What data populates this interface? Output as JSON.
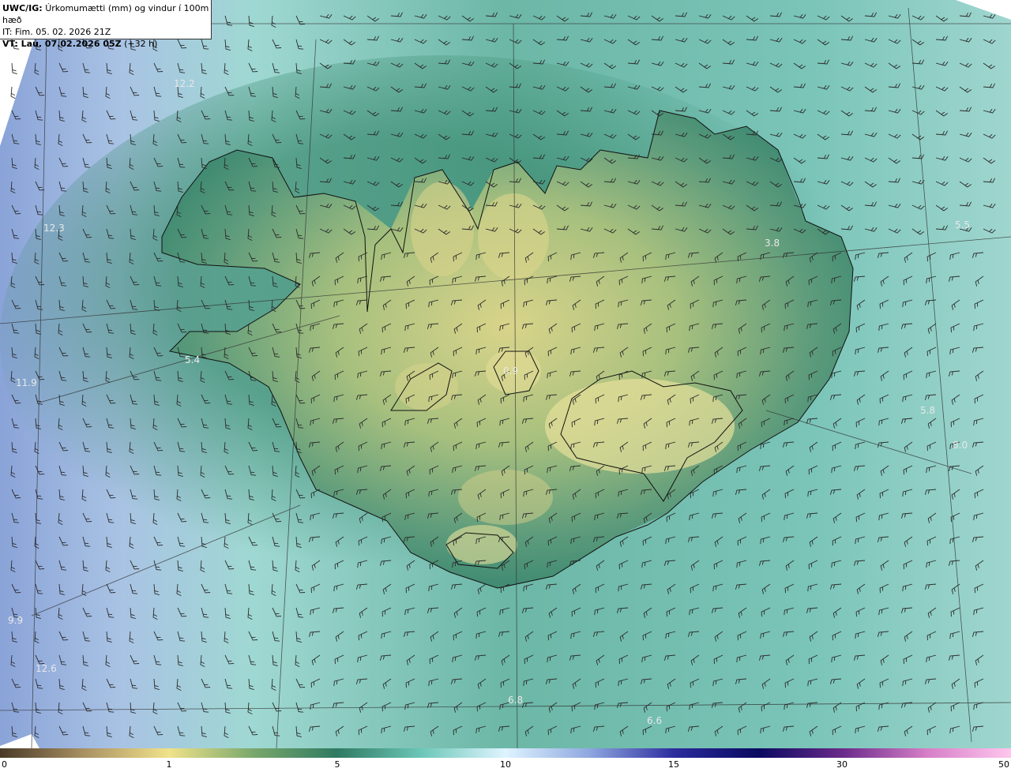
{
  "header": {
    "product": "UWC/IG:",
    "title": "Úrkomumætti (mm) og vindur í 100m hæð",
    "init_time": "IT: Fim. 05. 02. 2026 21Z",
    "valid_time_bold": "VT: Lau. 07.02.2026 05Z",
    "valid_time_rest": "(+32 h)"
  },
  "colorbar": {
    "ticks": [
      "0",
      "1",
      "5",
      "10",
      "15",
      "30",
      "50"
    ],
    "colors": [
      "#4a3a28",
      "#a99163",
      "#f0e28a",
      "#7aa86c",
      "#2f7a62",
      "#6cc7b8",
      "#dff4ff",
      "#8ea7e0",
      "#2c2c9e",
      "#0a0a60",
      "#6a2a8a",
      "#d67fc7",
      "#ffc6ee"
    ]
  },
  "map_values": [
    {
      "text": "12.2"
    },
    {
      "text": "12.3"
    },
    {
      "text": "11.9"
    },
    {
      "text": "5.4"
    },
    {
      "text": "0.9"
    },
    {
      "text": "3.8"
    },
    {
      "text": "5.5"
    },
    {
      "text": "5.8"
    },
    {
      "text": "8.0"
    },
    {
      "text": "9.9"
    },
    {
      "text": "12.6"
    },
    {
      "text": "6.8"
    },
    {
      "text": "6.6"
    }
  ]
}
